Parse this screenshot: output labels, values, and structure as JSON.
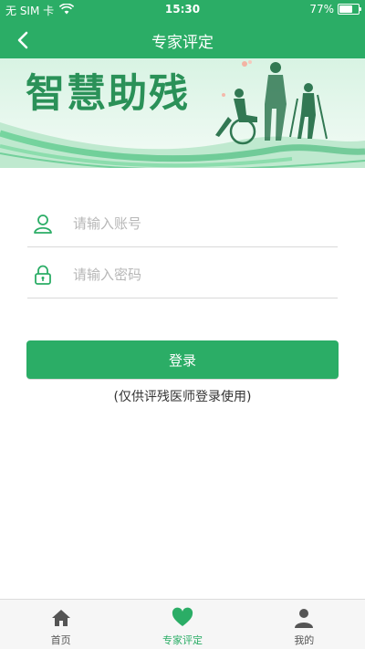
{
  "status_bar": {
    "carrier": "无 SIM 卡",
    "time": "15:30",
    "battery_text": "77%",
    "battery_level": 0.77
  },
  "nav": {
    "title": "专家评定",
    "back_icon": "chevron-left-icon"
  },
  "banner": {
    "title": "智慧助残"
  },
  "login": {
    "account_placeholder": "请输入账号",
    "account_value": "",
    "password_placeholder": "请输入密码",
    "password_value": "",
    "button_label": "登录",
    "note": "(仅供评残医师登录使用)"
  },
  "tabbar": {
    "items": [
      {
        "label": "首页",
        "icon": "home-icon",
        "active": false
      },
      {
        "label": "专家评定",
        "icon": "heart-icon",
        "active": true
      },
      {
        "label": "我的",
        "icon": "user-icon",
        "active": false
      }
    ]
  },
  "colors": {
    "accent": "#2bad66",
    "banner_text": "#2a9158",
    "tab_inactive": "#555555",
    "divider": "#d9d9d9"
  }
}
